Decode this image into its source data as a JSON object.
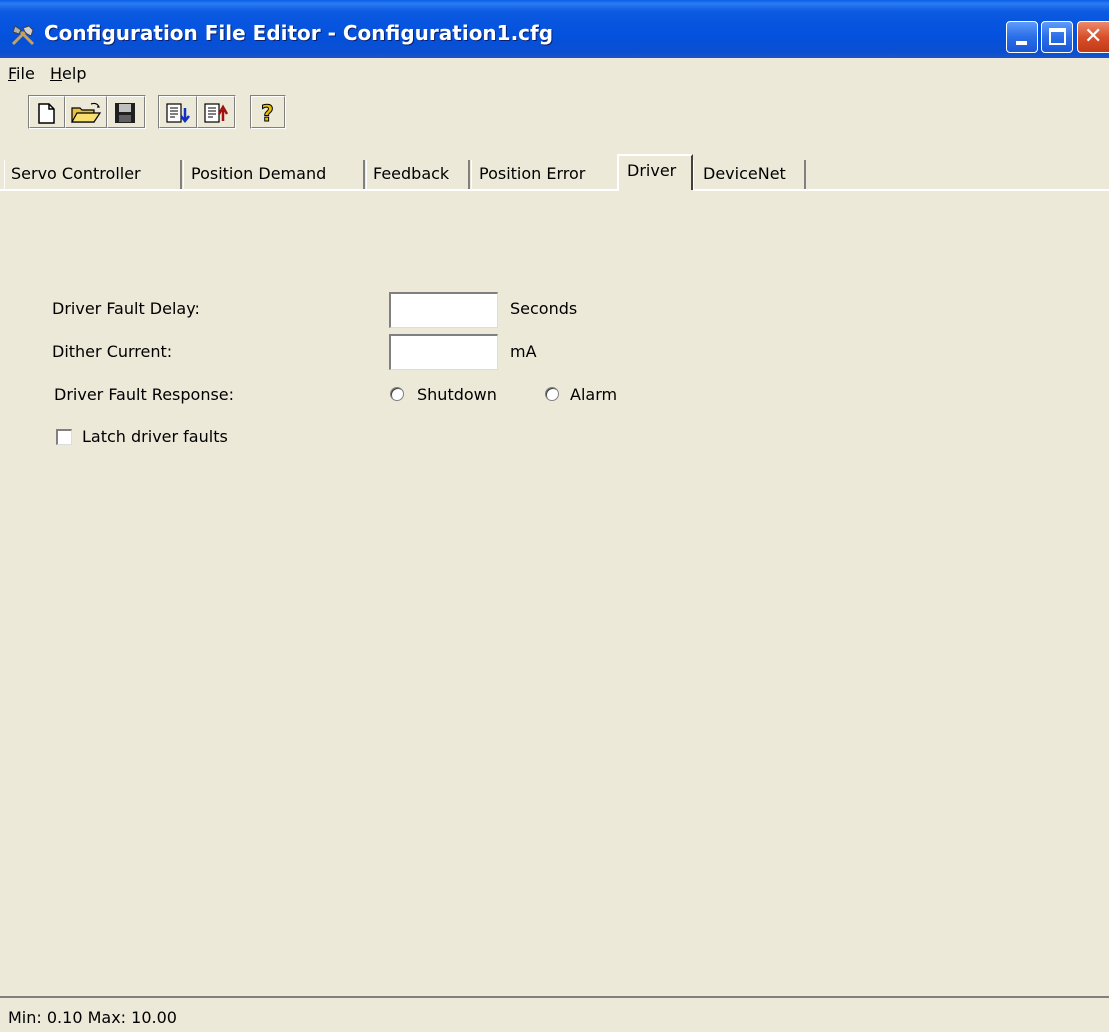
{
  "window": {
    "title": "Configuration File Editor - Configuration1.cfg",
    "icon": "tools-icon"
  },
  "menu": {
    "file": {
      "accel": "F",
      "rest": "ile"
    },
    "help": {
      "accel": "H",
      "rest": "elp"
    }
  },
  "toolbar": {
    "groups": [
      [
        "new-file-icon",
        "open-folder-icon",
        "save-disk-icon"
      ],
      [
        "download-config-icon",
        "upload-config-icon"
      ],
      [
        "help-question-icon"
      ]
    ]
  },
  "tabs": [
    {
      "label": "Servo Controller",
      "active": false
    },
    {
      "label": "Position Demand",
      "active": false
    },
    {
      "label": "Feedback",
      "active": false
    },
    {
      "label": "Position Error",
      "active": false
    },
    {
      "label": "Driver",
      "active": true
    },
    {
      "label": "DeviceNet",
      "active": false
    }
  ],
  "form": {
    "fault_delay_label": "Driver Fault Delay:",
    "fault_delay_value": "",
    "fault_delay_unit": "Seconds",
    "dither_label": "Dither Current:",
    "dither_value": "",
    "dither_unit": "mA",
    "response_label": "Driver Fault Response:",
    "response_shutdown": "Shutdown",
    "response_alarm": "Alarm",
    "latch_label": "Latch driver faults",
    "latch_checked": false
  },
  "status": {
    "text": "Min: 0.10 Max: 10.00"
  }
}
